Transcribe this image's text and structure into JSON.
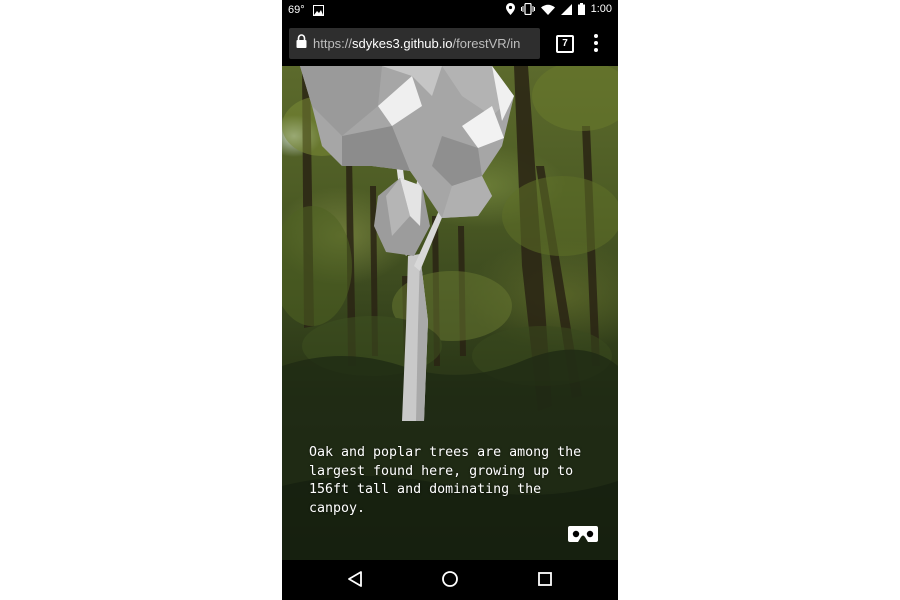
{
  "status_bar": {
    "temperature": "69°",
    "time": "1:00",
    "icons": [
      "image-icon",
      "location-icon",
      "vibrate-icon",
      "wifi-icon",
      "signal-icon",
      "battery-icon"
    ]
  },
  "browser": {
    "url_scheme": "https://",
    "url_host": "sdykes3.github.io",
    "url_path": "/forestVR/in",
    "tab_count": "7"
  },
  "scene": {
    "caption": "Oak and poplar trees are among the largest found here, growing up to 156ft tall and dominating the canpoy."
  },
  "navigation": {
    "buttons": [
      "back-icon",
      "home-icon",
      "recents-icon"
    ]
  },
  "colors": {
    "bar_background": "#000000",
    "url_box": "#2e2e2e",
    "tree_model": "#b8b8b8"
  }
}
